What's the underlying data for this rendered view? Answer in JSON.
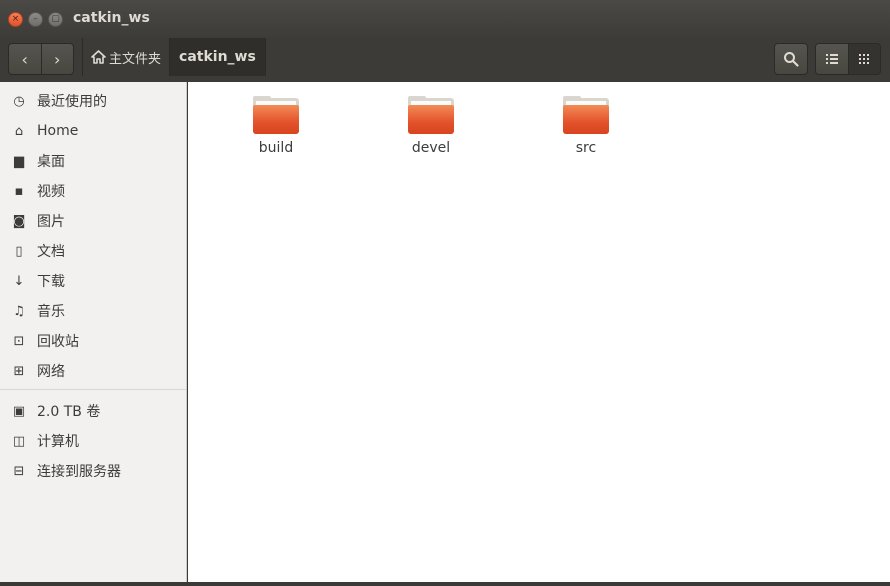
{
  "window": {
    "title": "catkin_ws",
    "close_glyph": "×",
    "min_glyph": "–",
    "max_glyph": "▢"
  },
  "toolbar": {
    "back_icon": "‹",
    "forward_icon": "›",
    "breadcrumbs": [
      {
        "label": "主文件夹",
        "icon": "home-icon"
      },
      {
        "label": "catkin_ws"
      }
    ]
  },
  "sidebar": {
    "items": [
      {
        "label": "最近使用的",
        "icon": "recent-icon",
        "glyph": "◷"
      },
      {
        "label": "Home",
        "icon": "home-icon",
        "glyph": "⌂"
      },
      {
        "label": "桌面",
        "icon": "desktop-folder-icon",
        "glyph": "▆"
      },
      {
        "label": "视频",
        "icon": "video-icon",
        "glyph": "▪"
      },
      {
        "label": "图片",
        "icon": "camera-icon",
        "glyph": "◙"
      },
      {
        "label": "文档",
        "icon": "document-icon",
        "glyph": "▯"
      },
      {
        "label": "下载",
        "icon": "download-icon",
        "glyph": "↓"
      },
      {
        "label": "音乐",
        "icon": "music-icon",
        "glyph": "♫"
      },
      {
        "label": "回收站",
        "icon": "trash-icon",
        "glyph": "⊡"
      },
      {
        "label": "网络",
        "icon": "network-icon",
        "glyph": "⊞"
      }
    ],
    "devices": [
      {
        "label": "2.0 TB 卷",
        "icon": "drive-icon",
        "glyph": "▣"
      },
      {
        "label": "计算机",
        "icon": "computer-icon",
        "glyph": "◫"
      },
      {
        "label": "连接到服务器",
        "icon": "server-icon",
        "glyph": "⊟"
      }
    ]
  },
  "files": [
    {
      "name": "build",
      "icon": "folder-icon"
    },
    {
      "name": "devel",
      "icon": "folder-icon"
    },
    {
      "name": "src",
      "icon": "folder-icon"
    }
  ],
  "colors": {
    "folder_accent": "#e3522b",
    "titlebar": "#3c3b37",
    "close_button": "#e0522a"
  }
}
